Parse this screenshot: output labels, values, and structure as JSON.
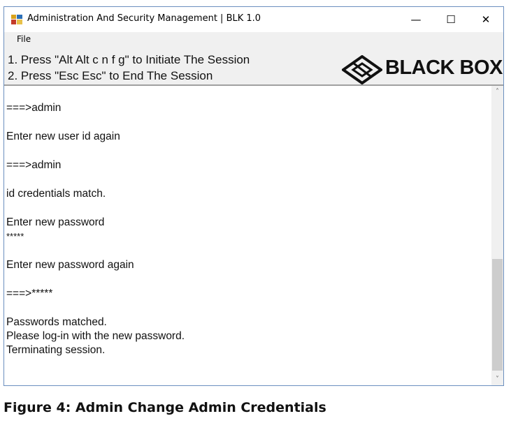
{
  "window": {
    "title": "Administration And Security Management  |  BLK 1.0",
    "minimize_glyph": "—",
    "maximize_glyph": "☐",
    "close_glyph": "✕"
  },
  "menu": {
    "file_label": "File"
  },
  "header": {
    "instruction_1": "1. Press \"Alt Alt c n f g\" to Initiate The Session",
    "instruction_2": "2. Press \"Esc Esc\" to End The Session",
    "logo_text": "BLACK BOX"
  },
  "console": {
    "lines": [
      "===>admin",
      "Enter new user id again",
      "===>admin",
      "id credentials match.",
      "Enter new password",
      "*****",
      "Enter new password again",
      "===>*****",
      "Passwords matched.",
      "Please log-in with the new password.",
      "Terminating session."
    ]
  },
  "scrollbar": {
    "up_glyph": "˄",
    "down_glyph": "˅",
    "position": 0.85
  },
  "caption": "Figure 4: Admin Change Admin Credentials",
  "colors": {
    "window_border": "#6b8fbf",
    "chrome": "#f0f0f0",
    "thumb": "#cdcdcd"
  }
}
